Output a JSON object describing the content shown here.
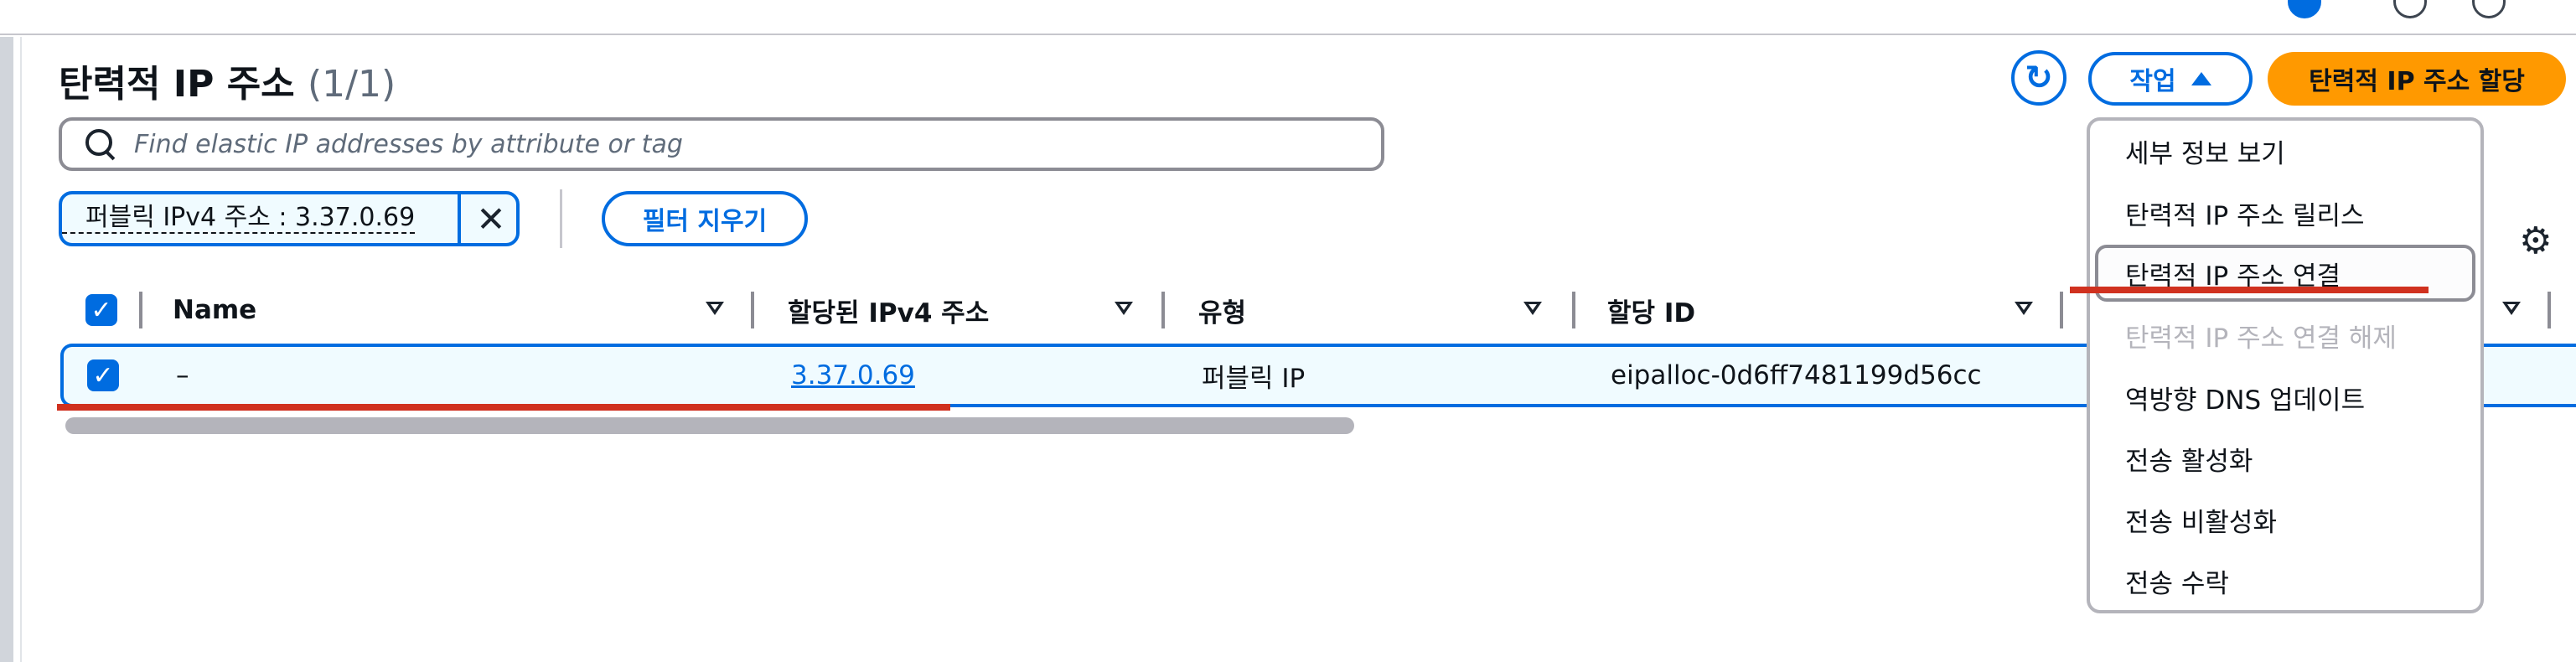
{
  "header": {
    "title": "탄력적 IP 주소",
    "count": "(1/1)",
    "actions_label": "작업",
    "allocate_label": "탄력적 IP 주소 할당"
  },
  "search": {
    "placeholder": "Find elastic IP addresses by attribute or tag"
  },
  "filter": {
    "token": "퍼블릭 IPv4 주소 : 3.37.0.69",
    "clear_label": "필터 지우기"
  },
  "table": {
    "columns": [
      "Name",
      "할당된 IPv4 주소",
      "유형",
      "할당 ID"
    ],
    "rows": [
      {
        "name": "–",
        "ipv4": "3.37.0.69",
        "type": "퍼블릭 IP",
        "allocation_id": "eipalloc-0d6ff7481199d56cc"
      }
    ]
  },
  "menu": {
    "items": [
      {
        "label": "세부 정보 보기",
        "disabled": false
      },
      {
        "label": "탄력적 IP 주소 릴리스",
        "disabled": false
      },
      {
        "label": "탄력적 IP 주소 연결",
        "disabled": false,
        "highlighted": true
      },
      {
        "label": "탄력적 IP 주소 연결 해제",
        "disabled": true
      },
      {
        "label": "역방향 DNS 업데이트",
        "disabled": false
      },
      {
        "label": "전송 활성화",
        "disabled": false
      },
      {
        "label": "전송 비활성화",
        "disabled": false
      },
      {
        "label": "전송 수락",
        "disabled": false
      }
    ]
  },
  "colors": {
    "accent": "#006ce0",
    "primary_button": "#ff9900",
    "annotation": "#d0311f",
    "disabled_text": "#b4b4bb"
  }
}
